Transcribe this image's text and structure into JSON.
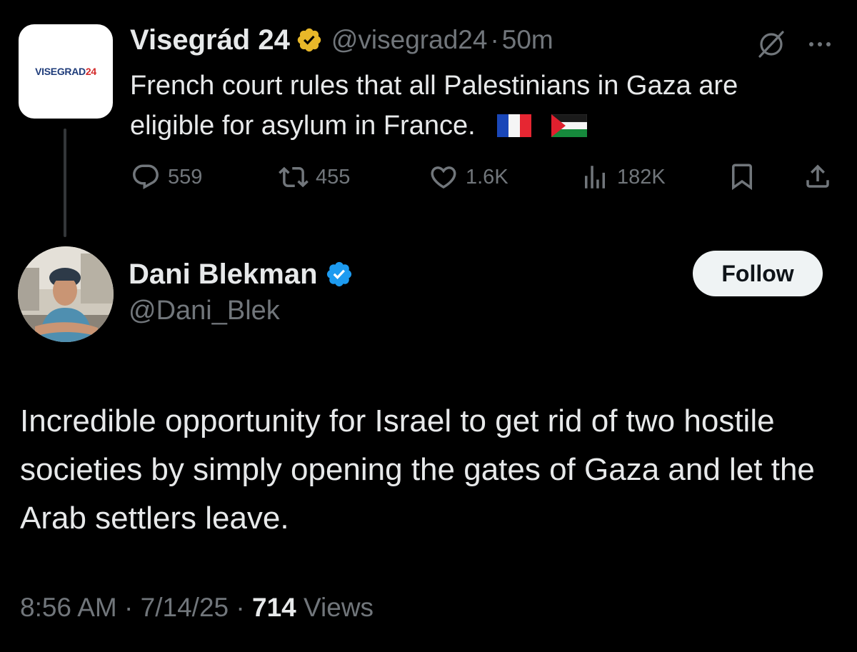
{
  "quoted_tweet": {
    "avatar_logo": {
      "primary": "VISEGRAD",
      "accent": "24"
    },
    "display_name": "Visegrád 24",
    "handle": "@visegrad24",
    "separator": "·",
    "time": "50m",
    "text": "French court rules that all Palestinians in Gaza are eligible for asylum in France.",
    "flags": [
      "flag-france-icon",
      "flag-palestine-icon"
    ],
    "badge_color": "#e8b829",
    "stats": {
      "replies": "559",
      "reposts": "455",
      "likes": "1.6K",
      "views": "182K"
    },
    "icons": [
      "grok-icon",
      "more-icon",
      "reply-icon",
      "repost-icon",
      "like-icon",
      "views-icon",
      "bookmark-icon",
      "share-icon"
    ]
  },
  "main_tweet": {
    "display_name": "Dani Blekman",
    "handle": "@Dani_Blek",
    "badge_color": "#1d9bf0",
    "follow_label": "Follow",
    "text": "Incredible opportunity for Israel to get rid of two hostile societies by simply opening the gates of Gaza and let the Arab settlers leave.",
    "meta": {
      "time": "8:56 AM",
      "separator": "·",
      "date": "7/14/25",
      "views_count": "714",
      "views_label": "Views"
    }
  },
  "colors": {
    "background": "#000000",
    "primary_text": "#e7e9ea",
    "secondary_text": "#71767b",
    "thread_line": "#333639",
    "follow_bg": "#eff3f4"
  }
}
